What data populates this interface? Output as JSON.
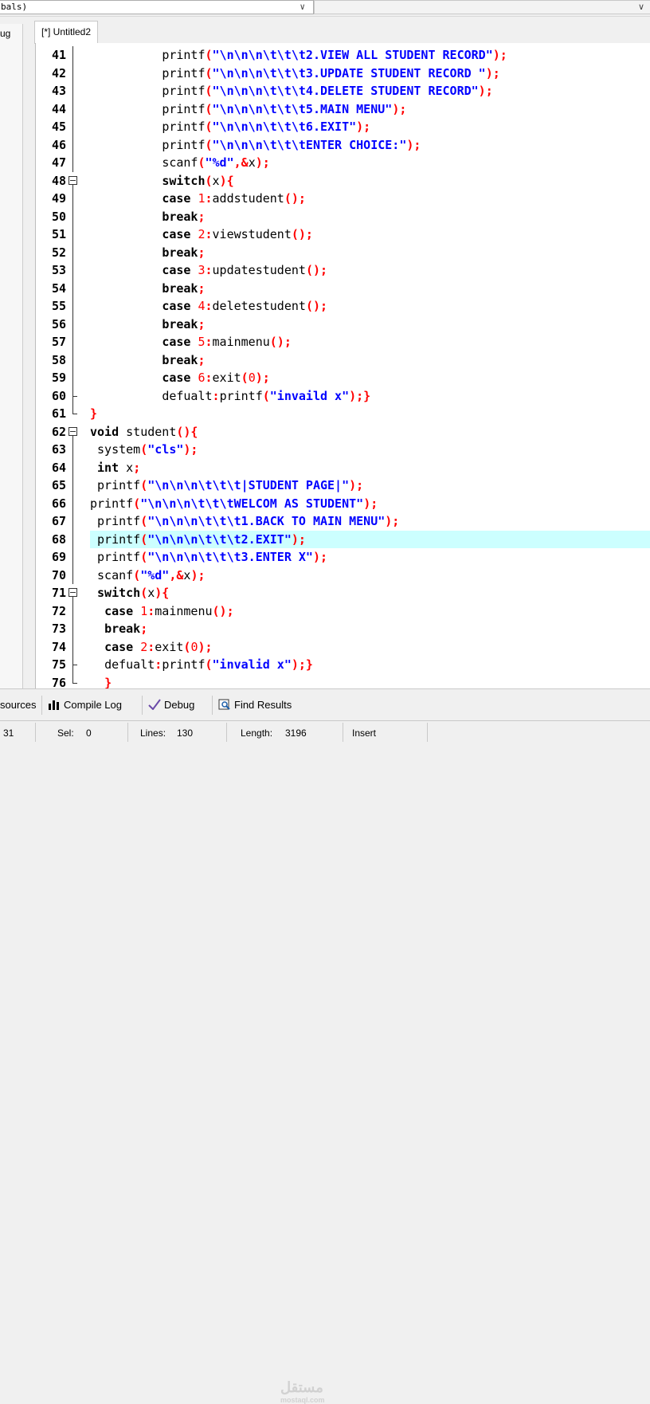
{
  "toolbar": {
    "class_combo_value": "bals)",
    "combo_arrow": "∨"
  },
  "tabs": {
    "left_panel_tab": "ug",
    "file_tab": "[*] Untitled2"
  },
  "editor": {
    "highlight_line": 68,
    "lines": [
      {
        "n": "41",
        "fold": "bar",
        "indent": "          ",
        "parts": [
          {
            "t": "printf",
            "c": "fn"
          },
          {
            "t": "(",
            "c": "sym"
          },
          {
            "t": "\"\\n\\n\\n\\t\\t\\t2.VIEW ALL STUDENT RECORD\"",
            "c": "str"
          },
          {
            "t": ");",
            "c": "sym"
          }
        ]
      },
      {
        "n": "42",
        "fold": "bar",
        "indent": "          ",
        "parts": [
          {
            "t": "printf",
            "c": "fn"
          },
          {
            "t": "(",
            "c": "sym"
          },
          {
            "t": "\"\\n\\n\\n\\t\\t\\t3.UPDATE STUDENT RECORD \"",
            "c": "str"
          },
          {
            "t": ");",
            "c": "sym"
          }
        ]
      },
      {
        "n": "43",
        "fold": "bar",
        "indent": "          ",
        "parts": [
          {
            "t": "printf",
            "c": "fn"
          },
          {
            "t": "(",
            "c": "sym"
          },
          {
            "t": "\"\\n\\n\\n\\t\\t\\t4.DELETE STUDENT RECORD\"",
            "c": "str"
          },
          {
            "t": ");",
            "c": "sym"
          }
        ]
      },
      {
        "n": "44",
        "fold": "bar",
        "indent": "          ",
        "parts": [
          {
            "t": "printf",
            "c": "fn"
          },
          {
            "t": "(",
            "c": "sym"
          },
          {
            "t": "\"\\n\\n\\n\\t\\t\\t5.MAIN MENU\"",
            "c": "str"
          },
          {
            "t": ");",
            "c": "sym"
          }
        ]
      },
      {
        "n": "45",
        "fold": "bar",
        "indent": "          ",
        "parts": [
          {
            "t": "printf",
            "c": "fn"
          },
          {
            "t": "(",
            "c": "sym"
          },
          {
            "t": "\"\\n\\n\\n\\t\\t\\t6.EXIT\"",
            "c": "str"
          },
          {
            "t": ");",
            "c": "sym"
          }
        ]
      },
      {
        "n": "46",
        "fold": "bar",
        "indent": "          ",
        "parts": [
          {
            "t": "printf",
            "c": "fn"
          },
          {
            "t": "(",
            "c": "sym"
          },
          {
            "t": "\"\\n\\n\\n\\t\\t\\tENTER CHOICE:\"",
            "c": "str"
          },
          {
            "t": ");",
            "c": "sym"
          }
        ]
      },
      {
        "n": "47",
        "fold": "bar",
        "indent": "          ",
        "parts": [
          {
            "t": "scanf",
            "c": "fn"
          },
          {
            "t": "(",
            "c": "sym"
          },
          {
            "t": "\"%d\"",
            "c": "str"
          },
          {
            "t": ",&",
            "c": "sym"
          },
          {
            "t": "x",
            "c": "fn"
          },
          {
            "t": ");",
            "c": "sym"
          }
        ]
      },
      {
        "n": "48",
        "fold": "box",
        "indent": "          ",
        "parts": [
          {
            "t": "switch",
            "c": "kw"
          },
          {
            "t": "(",
            "c": "sym"
          },
          {
            "t": "x",
            "c": "fn"
          },
          {
            "t": "){",
            "c": "sym"
          }
        ]
      },
      {
        "n": "49",
        "fold": "bar",
        "indent": "          ",
        "parts": [
          {
            "t": "case ",
            "c": "kw"
          },
          {
            "t": "1",
            "c": "num"
          },
          {
            "t": ":",
            "c": "sym"
          },
          {
            "t": "addstudent",
            "c": "fn"
          },
          {
            "t": "();",
            "c": "sym"
          }
        ]
      },
      {
        "n": "50",
        "fold": "bar",
        "indent": "          ",
        "parts": [
          {
            "t": "break",
            "c": "kw"
          },
          {
            "t": ";",
            "c": "sym"
          }
        ]
      },
      {
        "n": "51",
        "fold": "bar",
        "indent": "          ",
        "parts": [
          {
            "t": "case ",
            "c": "kw"
          },
          {
            "t": "2",
            "c": "num"
          },
          {
            "t": ":",
            "c": "sym"
          },
          {
            "t": "viewstudent",
            "c": "fn"
          },
          {
            "t": "();",
            "c": "sym"
          }
        ]
      },
      {
        "n": "52",
        "fold": "bar",
        "indent": "          ",
        "parts": [
          {
            "t": "break",
            "c": "kw"
          },
          {
            "t": ";",
            "c": "sym"
          }
        ]
      },
      {
        "n": "53",
        "fold": "bar",
        "indent": "          ",
        "parts": [
          {
            "t": "case ",
            "c": "kw"
          },
          {
            "t": "3",
            "c": "num"
          },
          {
            "t": ":",
            "c": "sym"
          },
          {
            "t": "updatestudent",
            "c": "fn"
          },
          {
            "t": "();",
            "c": "sym"
          }
        ]
      },
      {
        "n": "54",
        "fold": "bar",
        "indent": "          ",
        "parts": [
          {
            "t": "break",
            "c": "kw"
          },
          {
            "t": ";",
            "c": "sym"
          }
        ]
      },
      {
        "n": "55",
        "fold": "bar",
        "indent": "          ",
        "parts": [
          {
            "t": "case ",
            "c": "kw"
          },
          {
            "t": "4",
            "c": "num"
          },
          {
            "t": ":",
            "c": "sym"
          },
          {
            "t": "deletestudent",
            "c": "fn"
          },
          {
            "t": "();",
            "c": "sym"
          }
        ]
      },
      {
        "n": "56",
        "fold": "bar",
        "indent": "          ",
        "parts": [
          {
            "t": "break",
            "c": "kw"
          },
          {
            "t": ";",
            "c": "sym"
          }
        ]
      },
      {
        "n": "57",
        "fold": "bar",
        "indent": "          ",
        "parts": [
          {
            "t": "case ",
            "c": "kw"
          },
          {
            "t": "5",
            "c": "num"
          },
          {
            "t": ":",
            "c": "sym"
          },
          {
            "t": "mainmenu",
            "c": "fn"
          },
          {
            "t": "();",
            "c": "sym"
          }
        ]
      },
      {
        "n": "58",
        "fold": "bar",
        "indent": "          ",
        "parts": [
          {
            "t": "break",
            "c": "kw"
          },
          {
            "t": ";",
            "c": "sym"
          }
        ]
      },
      {
        "n": "59",
        "fold": "bar",
        "indent": "          ",
        "parts": [
          {
            "t": "case ",
            "c": "kw"
          },
          {
            "t": "6",
            "c": "num"
          },
          {
            "t": ":",
            "c": "sym"
          },
          {
            "t": "exit",
            "c": "fn"
          },
          {
            "t": "(",
            "c": "sym"
          },
          {
            "t": "0",
            "c": "num"
          },
          {
            "t": ");",
            "c": "sym"
          }
        ]
      },
      {
        "n": "60",
        "fold": "tick",
        "indent": "          ",
        "parts": [
          {
            "t": "defualt",
            "c": "fn"
          },
          {
            "t": ":",
            "c": "sym"
          },
          {
            "t": "printf",
            "c": "fn"
          },
          {
            "t": "(",
            "c": "sym"
          },
          {
            "t": "\"invaild x\"",
            "c": "str"
          },
          {
            "t": ");}",
            "c": "sym"
          }
        ]
      },
      {
        "n": "61",
        "fold": "end",
        "indent": "",
        "parts": [
          {
            "t": "}",
            "c": "sym"
          }
        ]
      },
      {
        "n": "62",
        "fold": "box",
        "indent": "",
        "parts": [
          {
            "t": "void ",
            "c": "kw"
          },
          {
            "t": "student",
            "c": "fn"
          },
          {
            "t": "(){",
            "c": "sym"
          }
        ]
      },
      {
        "n": "63",
        "fold": "bar",
        "indent": " ",
        "parts": [
          {
            "t": "system",
            "c": "fn"
          },
          {
            "t": "(",
            "c": "sym"
          },
          {
            "t": "\"cls\"",
            "c": "str"
          },
          {
            "t": ");",
            "c": "sym"
          }
        ]
      },
      {
        "n": "64",
        "fold": "bar",
        "indent": " ",
        "parts": [
          {
            "t": "int ",
            "c": "kw"
          },
          {
            "t": "x",
            "c": "fn"
          },
          {
            "t": ";",
            "c": "sym"
          }
        ]
      },
      {
        "n": "65",
        "fold": "bar",
        "indent": " ",
        "parts": [
          {
            "t": "printf",
            "c": "fn"
          },
          {
            "t": "(",
            "c": "sym"
          },
          {
            "t": "\"\\n\\n\\n\\t\\t\\t|STUDENT PAGE|\"",
            "c": "str"
          },
          {
            "t": ");",
            "c": "sym"
          }
        ]
      },
      {
        "n": "66",
        "fold": "bar",
        "indent": "",
        "parts": [
          {
            "t": "printf",
            "c": "fn"
          },
          {
            "t": "(",
            "c": "sym"
          },
          {
            "t": "\"\\n\\n\\n\\t\\t\\tWELCOM AS STUDENT\"",
            "c": "str"
          },
          {
            "t": ");",
            "c": "sym"
          }
        ]
      },
      {
        "n": "67",
        "fold": "bar",
        "indent": " ",
        "parts": [
          {
            "t": "printf",
            "c": "fn"
          },
          {
            "t": "(",
            "c": "sym"
          },
          {
            "t": "\"\\n\\n\\n\\t\\t\\t1.BACK TO MAIN MENU\"",
            "c": "str"
          },
          {
            "t": ");",
            "c": "sym"
          }
        ]
      },
      {
        "n": "68",
        "fold": "bar",
        "indent": " ",
        "parts": [
          {
            "t": "printf",
            "c": "fn"
          },
          {
            "t": "(",
            "c": "sym"
          },
          {
            "t": "\"\\n\\n\\n\\t\\t\\t2.EXIT\"",
            "c": "str"
          },
          {
            "t": ");",
            "c": "sym"
          }
        ]
      },
      {
        "n": "69",
        "fold": "bar",
        "indent": " ",
        "parts": [
          {
            "t": "printf",
            "c": "fn"
          },
          {
            "t": "(",
            "c": "sym"
          },
          {
            "t": "\"\\n\\n\\n\\t\\t\\t3.ENTER X\"",
            "c": "str"
          },
          {
            "t": ");",
            "c": "sym"
          }
        ]
      },
      {
        "n": "70",
        "fold": "bar",
        "indent": " ",
        "parts": [
          {
            "t": "scanf",
            "c": "fn"
          },
          {
            "t": "(",
            "c": "sym"
          },
          {
            "t": "\"%d\"",
            "c": "str"
          },
          {
            "t": ",&",
            "c": "sym"
          },
          {
            "t": "x",
            "c": "fn"
          },
          {
            "t": ");",
            "c": "sym"
          }
        ]
      },
      {
        "n": "71",
        "fold": "box",
        "indent": " ",
        "parts": [
          {
            "t": "switch",
            "c": "kw"
          },
          {
            "t": "(",
            "c": "sym"
          },
          {
            "t": "x",
            "c": "fn"
          },
          {
            "t": "){",
            "c": "sym"
          }
        ]
      },
      {
        "n": "72",
        "fold": "bar",
        "indent": "  ",
        "parts": [
          {
            "t": "case ",
            "c": "kw"
          },
          {
            "t": "1",
            "c": "num"
          },
          {
            "t": ":",
            "c": "sym"
          },
          {
            "t": "mainmenu",
            "c": "fn"
          },
          {
            "t": "();",
            "c": "sym"
          }
        ]
      },
      {
        "n": "73",
        "fold": "bar",
        "indent": "  ",
        "parts": [
          {
            "t": "break",
            "c": "kw"
          },
          {
            "t": ";",
            "c": "sym"
          }
        ]
      },
      {
        "n": "74",
        "fold": "bar",
        "indent": "  ",
        "parts": [
          {
            "t": "case ",
            "c": "kw"
          },
          {
            "t": "2",
            "c": "num"
          },
          {
            "t": ":",
            "c": "sym"
          },
          {
            "t": "exit",
            "c": "fn"
          },
          {
            "t": "(",
            "c": "sym"
          },
          {
            "t": "0",
            "c": "num"
          },
          {
            "t": ");",
            "c": "sym"
          }
        ]
      },
      {
        "n": "75",
        "fold": "tick",
        "indent": "  ",
        "parts": [
          {
            "t": "defualt",
            "c": "fn"
          },
          {
            "t": ":",
            "c": "sym"
          },
          {
            "t": "printf",
            "c": "fn"
          },
          {
            "t": "(",
            "c": "sym"
          },
          {
            "t": "\"invalid x\"",
            "c": "str"
          },
          {
            "t": ");}",
            "c": "sym"
          }
        ]
      },
      {
        "n": "76",
        "fold": "end",
        "indent": "  ",
        "parts": [
          {
            "t": "}",
            "c": "sym"
          }
        ]
      }
    ]
  },
  "bottom_tabs": {
    "resources": "sources",
    "compile_log": "Compile Log",
    "debug": "Debug",
    "find_results": "Find Results"
  },
  "watermark": {
    "text": "مستقل",
    "sub": "mostaql.com"
  },
  "status": {
    "line": "31",
    "sel_label": "Sel:",
    "sel_value": "0",
    "lines_label": "Lines:",
    "lines_value": "130",
    "length_label": "Length:",
    "length_value": "3196",
    "mode": "Insert"
  },
  "colors": {
    "keyword": "#000000",
    "string": "#0000ff",
    "number": "#ff0000",
    "symbol": "#ff0000",
    "highlight": "#ccffff"
  }
}
